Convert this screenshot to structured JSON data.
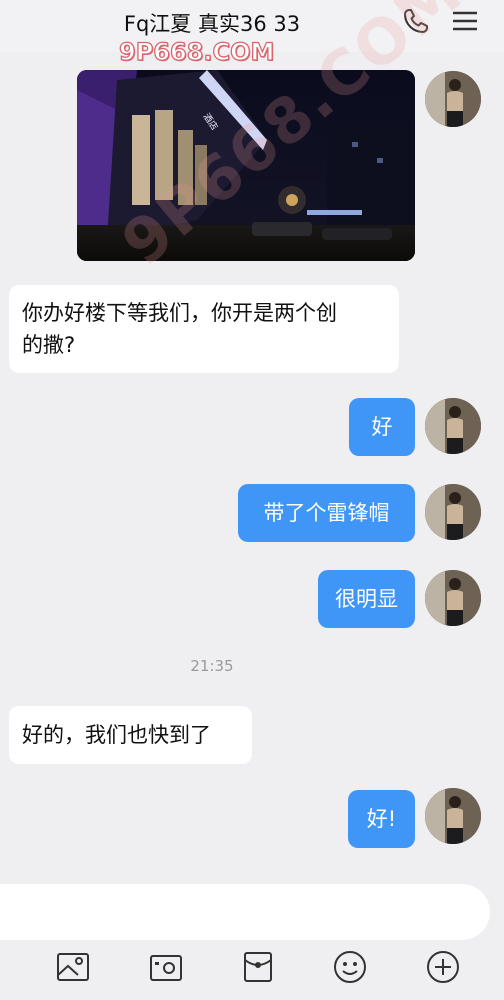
{
  "header": {
    "title": "Fq江夏  真实36  33",
    "phone_icon": "phone-icon",
    "menu_icon": "hamburger-menu-icon"
  },
  "watermarks": {
    "logo_text": "9P668.COM",
    "diagonal_text": "9P668.COM"
  },
  "messages": [
    {
      "type": "image",
      "side": "right",
      "content": "night building entrance photo"
    },
    {
      "type": "text",
      "side": "left",
      "text_line1": "你办好楼下等我们，你开是两个创",
      "text_line2": "的撒?"
    },
    {
      "type": "text",
      "side": "right",
      "text": "好"
    },
    {
      "type": "text",
      "side": "right",
      "text": "带了个雷锋帽"
    },
    {
      "type": "text",
      "side": "right",
      "text": "很明显"
    },
    {
      "type": "time",
      "text": "21:35"
    },
    {
      "type": "text",
      "side": "left",
      "text": "好的，我们也快到了"
    },
    {
      "type": "text",
      "side": "right",
      "text": "好!"
    }
  ],
  "input": {
    "placeholder": ""
  },
  "toolbar": {
    "icons": [
      "image-icon",
      "camera-icon",
      "red-packet-icon",
      "emoji-icon",
      "plus-icon"
    ]
  },
  "colors": {
    "outgoing_bubble": "#4096f6",
    "incoming_bubble": "#ffffff",
    "background": "#efeff1",
    "watermark": "#d8666e"
  }
}
